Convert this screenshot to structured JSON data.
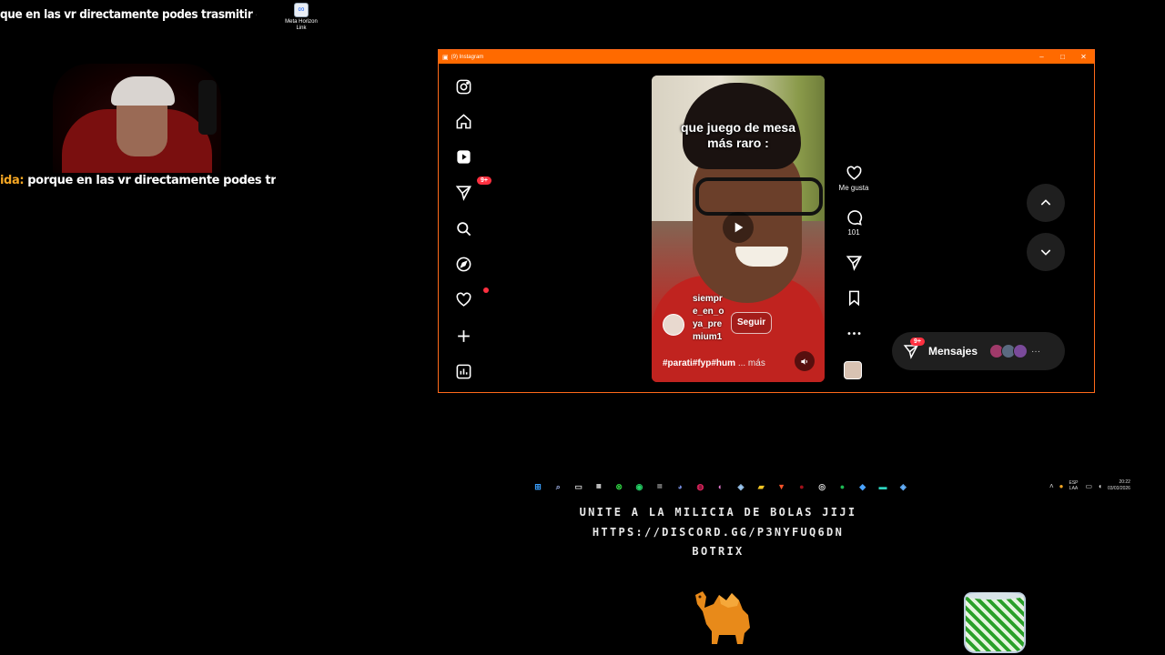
{
  "overlay": {
    "chat_top_text": "que en las vr directamente podes trasmitir en las vr",
    "chat_line_user": "ida:",
    "chat_line_message": " porque en las vr directamente podes trasmitir en las vr",
    "desktop_icon_label": "Meta Horizon Link",
    "banner_lines": [
      "UNITE A LA MILICIA DE BOLAS JIJI",
      "HTTPS://DISCORD.GG/P3NYFUQ6DN",
      "BOTRIX"
    ]
  },
  "window": {
    "title": "(9) Instagram",
    "controls": [
      "–",
      "□",
      "✕"
    ],
    "accent_color": "#ff6a00"
  },
  "sidebar": {
    "items": [
      {
        "icon": "instagram-logo-icon"
      },
      {
        "icon": "home-icon"
      },
      {
        "icon": "reels-icon"
      },
      {
        "icon": "messages-icon",
        "badge": "9+"
      },
      {
        "icon": "search-icon"
      },
      {
        "icon": "explore-icon"
      },
      {
        "icon": "notifications-heart-icon",
        "dot": true
      },
      {
        "icon": "create-plus-icon"
      },
      {
        "icon": "dashboard-icon"
      }
    ]
  },
  "reel": {
    "caption_line1": "que juego de mesa",
    "caption_line2": "más raro :",
    "author": "siempre_en_oya_premium1",
    "follow_label": "Seguir",
    "hashtags": "#parati#fyp#hum",
    "more_label": "... más",
    "is_playing": false,
    "muted": false
  },
  "actions": {
    "like_label": "Me gusta",
    "comments_count": "101"
  },
  "messages_bar": {
    "label": "Mensajes",
    "badge": "9+",
    "more": "···"
  },
  "taskbar": {
    "icons": [
      "windows-start-icon",
      "search-icon",
      "task-view-icon",
      "calculator-icon",
      "xbox-icon",
      "whatsapp-icon",
      "app-icon",
      "discord-icon",
      "app-red-icon",
      "app-color-icon",
      "steam-icon",
      "file-explorer-icon",
      "brave-icon",
      "app-dark-red-icon",
      "app-circle-icon",
      "spotify-icon",
      "app-blue-icon",
      "app-terminal-icon",
      "steam-blue-icon"
    ],
    "tray": {
      "lang_top": "ESP",
      "lang_bottom": "LAA",
      "time": "20:22",
      "date": "03/03/2026"
    }
  }
}
